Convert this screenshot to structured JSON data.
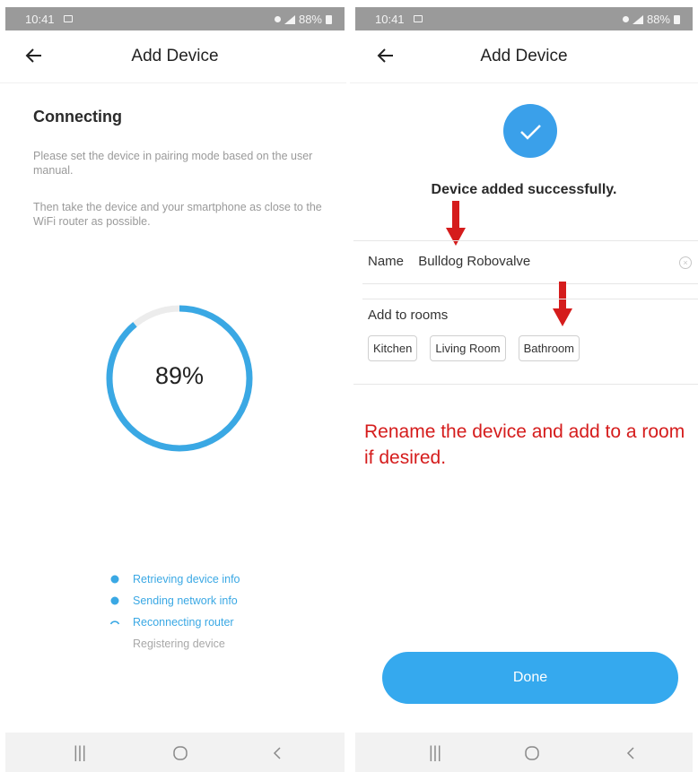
{
  "left_screen": {
    "status_bar": {
      "time": "10:41",
      "battery": "88%"
    },
    "header": {
      "title": "Add Device"
    },
    "heading": "Connecting",
    "instructions": [
      "Please set the device in pairing mode based on the user manual.",
      "Then take the device and your smartphone as close to the WiFi router as possible."
    ],
    "progress": {
      "label": "89%",
      "value": 89
    },
    "steps": [
      {
        "label": "Retrieving device info",
        "state": "done"
      },
      {
        "label": "Sending network info",
        "state": "done"
      },
      {
        "label": "Reconnecting router",
        "state": "in-progress"
      },
      {
        "label": "Registering device",
        "state": "pending"
      }
    ]
  },
  "right_screen": {
    "status_bar": {
      "time": "10:41",
      "battery": "88%"
    },
    "header": {
      "title": "Add Device"
    },
    "success_message": "Device added successfully.",
    "name_field": {
      "label": "Name",
      "value": "Bulldog Robovalve"
    },
    "rooms": {
      "label": "Add to rooms",
      "options": [
        "Kitchen",
        "Living Room",
        "Bathroom"
      ]
    },
    "annotation": "Rename the device and add to a room if desired.",
    "done_button": "Done"
  },
  "colors": {
    "accent": "#3aa8e4",
    "button": "#35a9ee",
    "annotation": "#d51c1c",
    "status_bar": "#9a9a9a"
  },
  "icons": [
    "back-arrow-icon",
    "check-icon",
    "red-arrow-icon",
    "clear-icon",
    "recent-apps-icon",
    "home-icon",
    "back-icon"
  ]
}
